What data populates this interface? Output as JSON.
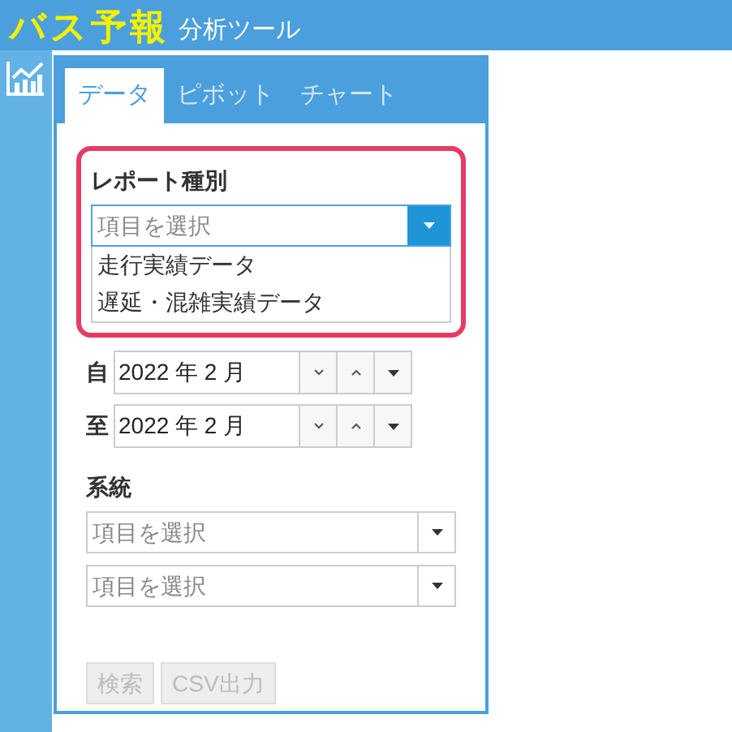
{
  "header": {
    "logo": "バス予報",
    "subtitle": "分析ツール"
  },
  "tabs": [
    {
      "label": "データ",
      "selected": true
    },
    {
      "label": "ピボット",
      "selected": false
    },
    {
      "label": "チャート",
      "selected": false
    }
  ],
  "report_type": {
    "label": "レポート種別",
    "placeholder": "項目を選択",
    "options": [
      "走行実績データ",
      "遅延・混雑実績データ"
    ]
  },
  "date_range": [
    {
      "label": "自",
      "value": "2022 年 2 月"
    },
    {
      "label": "至",
      "value": "2022 年 2 月"
    }
  ],
  "route": {
    "label": "系統",
    "selects": [
      {
        "placeholder": "項目を選択"
      },
      {
        "placeholder": "項目を選択"
      }
    ]
  },
  "buttons": [
    {
      "label": "検索",
      "disabled": true
    },
    {
      "label": "CSV出力",
      "disabled": true
    }
  ]
}
